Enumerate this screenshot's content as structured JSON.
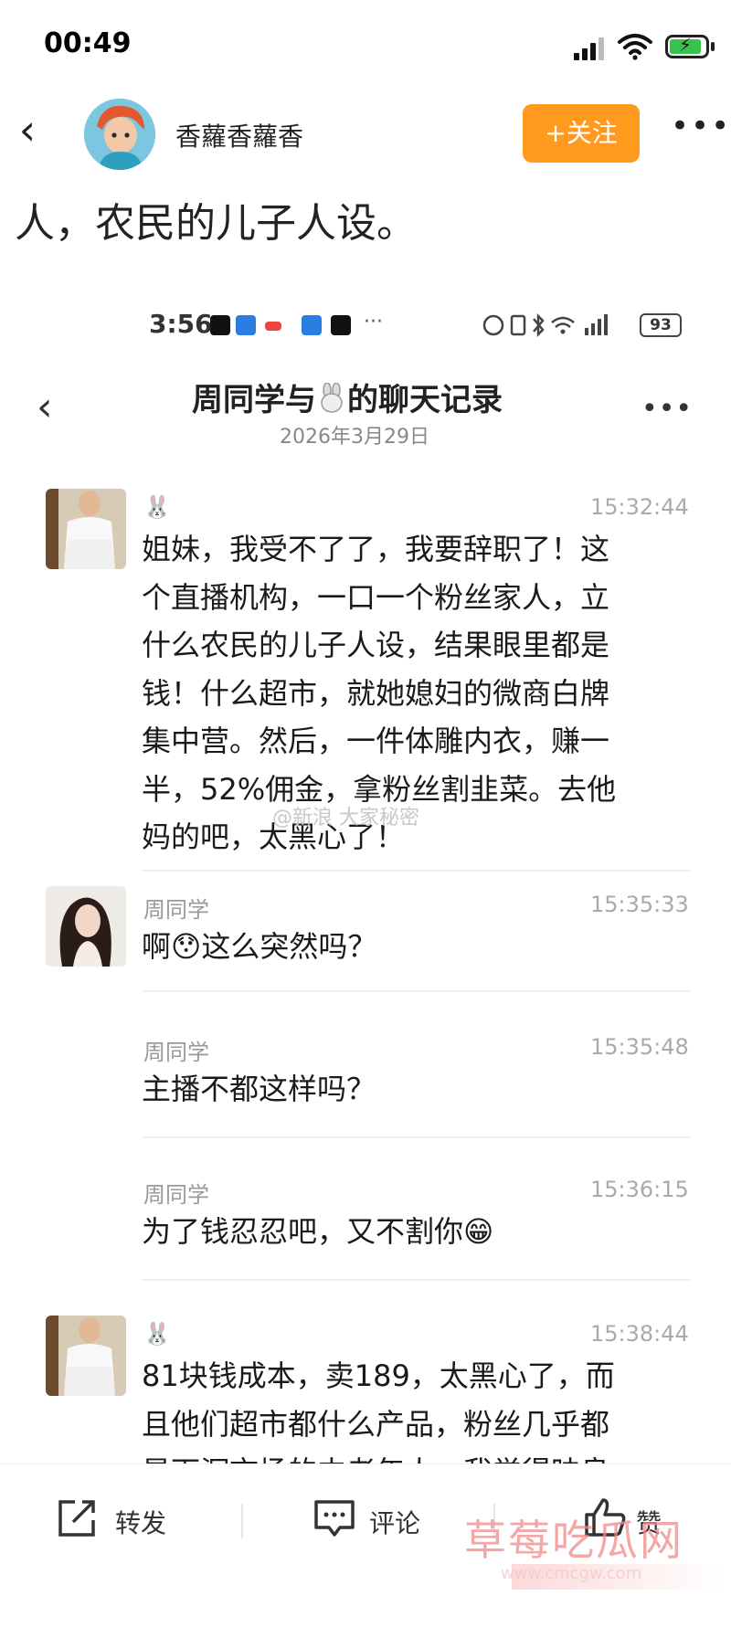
{
  "status_bar": {
    "time": "00:49"
  },
  "header": {
    "username": "香蘿香蘿香",
    "follow_label": "+关注"
  },
  "post": {
    "text_fragment": "人，农民的儿子人设。"
  },
  "screenshot": {
    "status_time": "3:56",
    "status_dots": "···",
    "battery": "93",
    "chat_title_prefix": "周同学与",
    "chat_title_suffix": "的聊天记录",
    "chat_date": "2026年3月29日",
    "messages": [
      {
        "sender": "🐰",
        "time": "15:32:44",
        "lines": [
          "姐妹，我受不了了，我要辞职了！这",
          "个直播机构，一口一个粉丝家人，立",
          "什么农民的儿子人设，结果眼里都是",
          "钱！什么超市，就她媳妇的微商白牌",
          "集中营。然后，一件体雕内衣，赚一",
          "半，52%佣金，拿粉丝割韭菜。去他",
          "妈的吧，太黑心了！"
        ]
      },
      {
        "sender": "周同学",
        "time": "15:35:33",
        "lines": [
          "啊😯这么突然吗？"
        ]
      },
      {
        "sender": "周同学",
        "time": "15:35:48",
        "lines": [
          "主播不都这样吗？"
        ]
      },
      {
        "sender": "周同学",
        "time": "15:36:15",
        "lines": [
          "为了钱忍忍吧，又不割你😁"
        ]
      },
      {
        "sender": "🐰",
        "time": "15:38:44",
        "lines": [
          "81块钱成本，卖189，太黑心了，而",
          "且他们超市都什么产品，粉丝几乎都",
          "是下沉市场的中老年人，我觉得昧良"
        ]
      }
    ],
    "watermark_mid": "@新浪 大家秘密"
  },
  "bottom_bar": {
    "repost_label": "转发",
    "comment_label": "评论",
    "like_label": "赞"
  },
  "watermark": {
    "site_name": "草莓吃瓜网",
    "site_url": "www.cmcgw.com"
  },
  "colors": {
    "follow_button": "#ff9a1f",
    "battery_fill": "#38c24e",
    "watermark": "#f08a8a"
  }
}
